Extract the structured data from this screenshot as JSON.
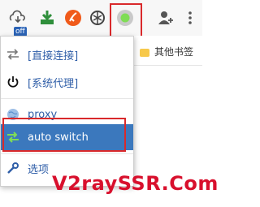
{
  "toolbar": {
    "icons": [
      "cloud-download-icon",
      "off-badge-icon",
      "download-arrow-icon",
      "orange-extension-icon",
      "openai-knot-icon",
      "switchyomega-icon",
      "profile-icon"
    ],
    "off_badge": "off",
    "highlight_color": "#d9292b"
  },
  "bookmarks": {
    "folder_label": "其他书签"
  },
  "menu": {
    "items": [
      {
        "label": "[直接连接]",
        "icon": "direct-connection-icon"
      },
      {
        "label": "[系统代理]",
        "icon": "power-icon"
      },
      {
        "label": "proxy",
        "icon": "globe-icon"
      },
      {
        "label": "auto switch",
        "icon": "auto-switch-icon",
        "selected": true
      },
      {
        "label": "选项",
        "icon": "wrench-icon"
      }
    ],
    "selected_color": "#3b78bd"
  },
  "watermark": {
    "text": "V2raySSR.Com",
    "color": "#d8102d"
  }
}
